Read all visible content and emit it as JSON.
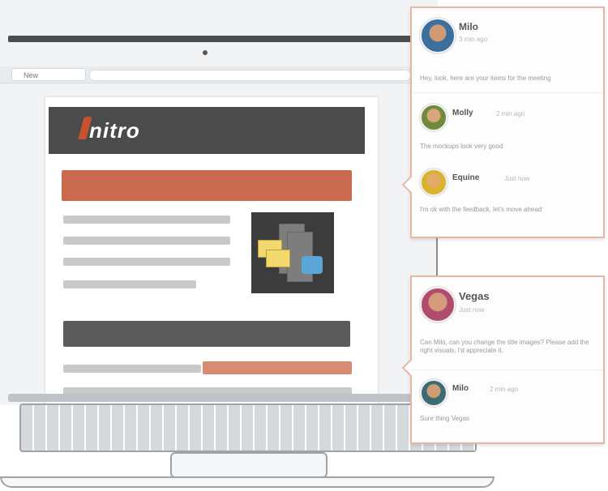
{
  "browser": {
    "tab_label": "New"
  },
  "page": {
    "logo_text": "nitro"
  },
  "cards": [
    {
      "comments": [
        {
          "name": "Milo",
          "time": "3 min ago",
          "text": "Hey, look, here are your items for the meeting"
        },
        {
          "name": "Molly",
          "time": "2 min ago",
          "text": "The mockups look very good"
        },
        {
          "name": "Equine",
          "time": "Just now",
          "text": "I'm ok with the feedback, let's move ahead"
        }
      ]
    },
    {
      "comments": [
        {
          "name": "Vegas",
          "time": "Just now",
          "text": "Can Milo, can you change the title images? Please add the right visuals, I'd appreciate it."
        },
        {
          "name": "Milo",
          "time": "2 min ago",
          "text": "Sure thing Vegas"
        }
      ]
    }
  ],
  "colors": {
    "accent_orange": "#c96a4f",
    "header_dark": "#4b4b4b",
    "card_border": "#e6b6a6"
  }
}
